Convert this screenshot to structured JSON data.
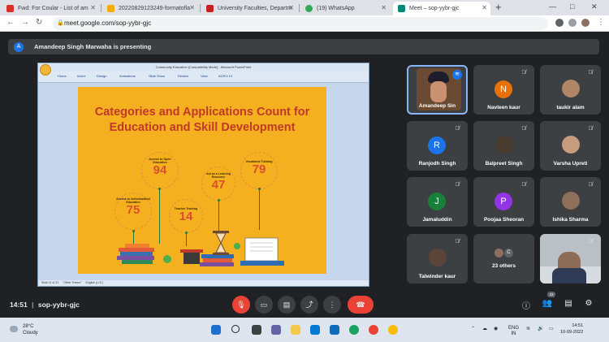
{
  "browser": {
    "tabs": [
      {
        "label": "Fwd: For Coular - List of am",
        "color": "#d93025"
      },
      {
        "label": "20220829123249-formatofla",
        "color": "#f9ab00"
      },
      {
        "label": "University Faculties, Departm",
        "color": "#c5221f"
      },
      {
        "label": "(19) WhatsApp",
        "color": "#34a853"
      },
      {
        "label": "Meet – sop-yybr-gjc",
        "color": "#00897b"
      }
    ],
    "url": "meet.google.com/sop-yybr-gjc",
    "new_tab": "+",
    "minimize": "—",
    "maximize": "□",
    "close": "✕"
  },
  "presenting": {
    "avatar": "A",
    "text": "Amandeep Singh Marwaha is presenting"
  },
  "ppt": {
    "title": "Community Education [Compatibility Mode] - Microsoft PowerPoint",
    "ribbon": [
      "Home",
      "Insert",
      "Design",
      "Animations",
      "Slide Show",
      "Review",
      "View",
      "ACRO 10"
    ],
    "status": [
      "Slide 11 of 22",
      "\"Office Theme\"",
      "English (U.S.)"
    ]
  },
  "slide": {
    "title_line1": "Categories and Applications Count for",
    "title_line2": "Education and Skill Development",
    "stats": [
      {
        "label": "Access to Open Education",
        "value": "94"
      },
      {
        "label": "Access to Individualized Education",
        "value": "75"
      },
      {
        "label": "Teacher Training",
        "value": "14"
      },
      {
        "label": "Aid as a Learning Resource",
        "value": "47"
      },
      {
        "label": "Vocational Training",
        "value": "79"
      }
    ]
  },
  "participants": [
    {
      "name": "Amandeep Sin",
      "type": "photo",
      "color": "#6b4a33"
    },
    {
      "name": "Navleen kaur",
      "type": "letter",
      "letter": "N",
      "color": "#e8710a"
    },
    {
      "name": "taukir alam",
      "type": "photo",
      "color": "#b08667"
    },
    {
      "name": "Ranjodh Singh",
      "type": "letter",
      "letter": "R",
      "color": "#1a73e8"
    },
    {
      "name": "Balpreet Singh",
      "type": "photo",
      "color": "#4a3b2f"
    },
    {
      "name": "Varsha Upreti",
      "type": "photo",
      "color": "#c79c7e"
    },
    {
      "name": "Jamaluddin",
      "type": "letter",
      "letter": "J",
      "color": "#188038"
    },
    {
      "name": "Poojaa Sheoran",
      "type": "letter",
      "letter": "P",
      "color": "#9334e6"
    },
    {
      "name": "Ishika Sharma",
      "type": "photo",
      "color": "#8e6f5a"
    },
    {
      "name": "Talwinder kaur",
      "type": "photo",
      "color": "#5b4538"
    },
    {
      "name": "23 others",
      "type": "others",
      "letter": "C",
      "color": "#5f6368"
    },
    {
      "name": "",
      "type": "video",
      "color": "#b9c1c7"
    }
  ],
  "meeting": {
    "time": "14:51",
    "code": "sop-yybr-gjc",
    "people_count": "33"
  },
  "taskbar": {
    "temp": "28°C",
    "weather": "Cloudy",
    "lang1": "ENG",
    "lang2": "IN",
    "time": "14:51",
    "date": "10-09-2022"
  }
}
